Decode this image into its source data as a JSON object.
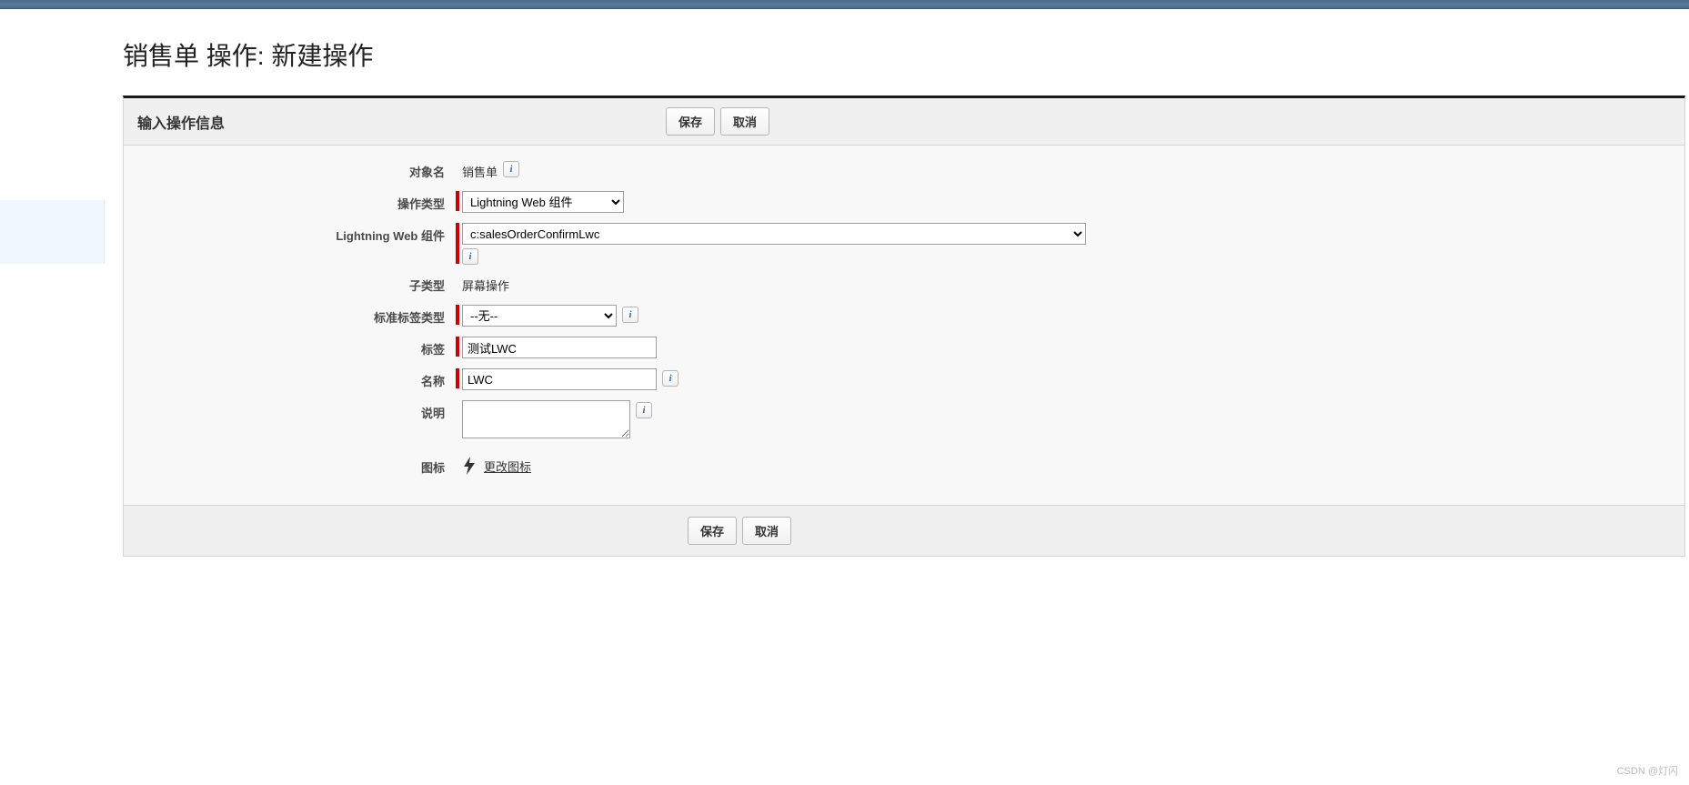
{
  "header": {
    "page_title": "销售单 操作: 新建操作"
  },
  "panel": {
    "section_title": "输入操作信息",
    "save_label": "保存",
    "cancel_label": "取消"
  },
  "form": {
    "object_name": {
      "label": "对象名",
      "value": "销售单"
    },
    "action_type": {
      "label": "操作类型",
      "selected": "Lightning Web 组件"
    },
    "lwc": {
      "label": "Lightning Web 组件",
      "selected": "c:salesOrderConfirmLwc"
    },
    "sub_type": {
      "label": "子类型",
      "value": "屏幕操作"
    },
    "std_label_type": {
      "label": "标准标签类型",
      "selected": "--无--"
    },
    "label_field": {
      "label": "标签",
      "value": "测试LWC"
    },
    "name_field": {
      "label": "名称",
      "value": "LWC"
    },
    "description": {
      "label": "说明",
      "value": ""
    },
    "icon": {
      "label": "图标",
      "change_link": "更改图标"
    }
  },
  "footer": {
    "save_label": "保存",
    "cancel_label": "取消"
  },
  "watermark": "CSDN @灯闪"
}
